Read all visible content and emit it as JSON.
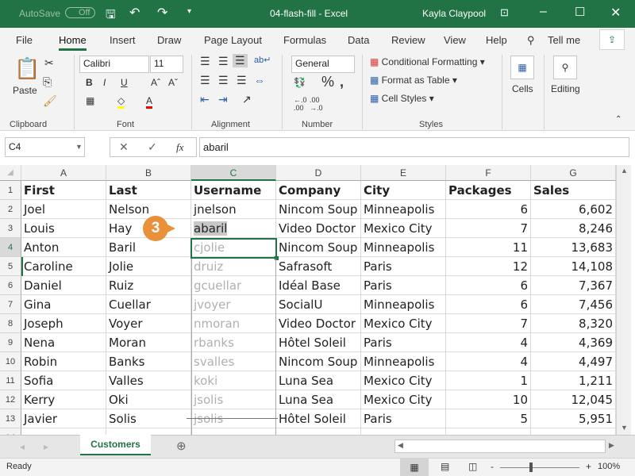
{
  "title": {
    "autosave": "AutoSave",
    "autosave_state": "Off",
    "doc": "04-flash-fill  -  Excel",
    "user": "Kayla Claypool"
  },
  "tabs": [
    "File",
    "Home",
    "Insert",
    "Draw",
    "Page Layout",
    "Formulas",
    "Data",
    "Review",
    "View",
    "Help"
  ],
  "tell_me": "Tell me",
  "ribbon": {
    "paste": "Paste",
    "font_name": "Calibri",
    "font_size": "11",
    "bold": "B",
    "italic": "I",
    "underline": "U",
    "number_format": "General",
    "cond_format": "Conditional Formatting",
    "format_table": "Format as Table",
    "cell_styles": "Cell Styles",
    "cells": "Cells",
    "editing": "Editing",
    "groups": [
      "Clipboard",
      "Font",
      "Alignment",
      "Number",
      "Styles"
    ]
  },
  "formula_bar": {
    "name_box": "C4",
    "fx": "fx",
    "value": "abaril"
  },
  "columns": [
    "A",
    "B",
    "C",
    "D",
    "E",
    "F",
    "G"
  ],
  "rows": [
    [
      "First",
      "Last",
      "Username",
      "Company",
      "City",
      "Packages",
      "Sales"
    ],
    [
      "Joel",
      "Nelson",
      "jnelson",
      "Nincom Soup",
      "Minneapolis",
      "6",
      "6,602"
    ],
    [
      "Louis",
      "Hay",
      "abaril",
      "Video Doctor",
      "Mexico City",
      "7",
      "8,246"
    ],
    [
      "Anton",
      "Baril",
      "cjolie",
      "Nincom Soup",
      "Minneapolis",
      "11",
      "13,683"
    ],
    [
      "Caroline",
      "Jolie",
      "druiz",
      "Safrasoft",
      "Paris",
      "12",
      "14,108"
    ],
    [
      "Daniel",
      "Ruiz",
      "gcuellar",
      "Idéal Base",
      "Paris",
      "6",
      "7,367"
    ],
    [
      "Gina",
      "Cuellar",
      "jvoyer",
      "SocialU",
      "Minneapolis",
      "6",
      "7,456"
    ],
    [
      "Joseph",
      "Voyer",
      "nmoran",
      "Video Doctor",
      "Mexico City",
      "7",
      "8,320"
    ],
    [
      "Nena",
      "Moran",
      "rbanks",
      "Hôtel Soleil",
      "Paris",
      "4",
      "4,369"
    ],
    [
      "Robin",
      "Banks",
      "svalles",
      "Nincom Soup",
      "Minneapolis",
      "4",
      "4,497"
    ],
    [
      "Sofia",
      "Valles",
      "koki",
      "Luna Sea",
      "Mexico City",
      "1",
      "1,211"
    ],
    [
      "Kerry",
      "Oki",
      "jsolis",
      "Luna Sea",
      "Mexico City",
      "10",
      "12,045"
    ],
    [
      "Javier",
      "Solis",
      "jsolis",
      "Hôtel Soleil",
      "Paris",
      "5",
      "5,951"
    ]
  ],
  "callout": "3",
  "sheet_tab": "Customers",
  "status": {
    "ready": "Ready",
    "zoom": "100%"
  },
  "colors": {
    "accent": "#217346",
    "callout": "#e8903a"
  }
}
